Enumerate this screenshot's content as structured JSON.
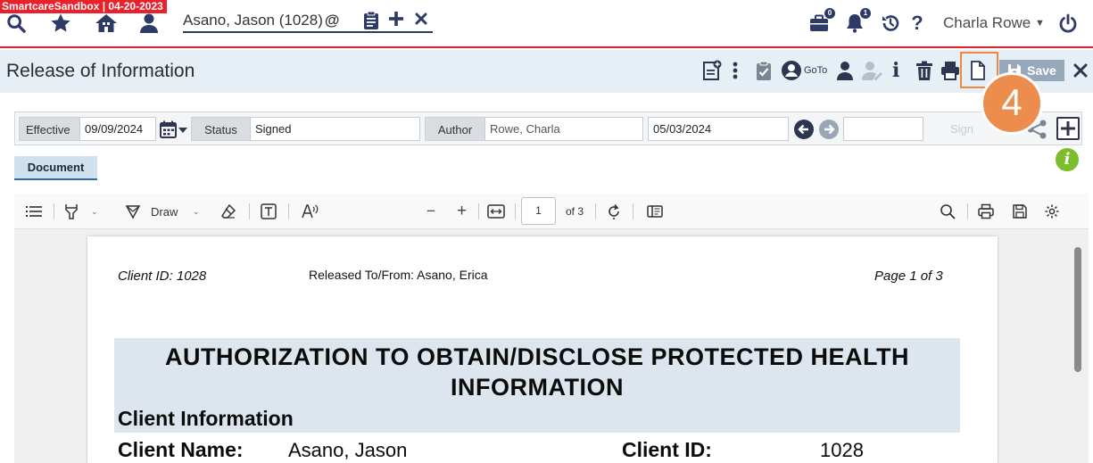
{
  "environment": {
    "badge": "SmartcareSandbox | 04-20-2023"
  },
  "nav": {
    "client_tab": {
      "label": "Asano, Jason (1028)",
      "at_symbol": "@"
    },
    "user": {
      "name": "Charla Rowe"
    },
    "notifications": {
      "briefcase_count": "0",
      "bell_count": "1"
    }
  },
  "title_bar": {
    "title": "Release of Information",
    "goto_label": "GoTo",
    "save_label": "Save"
  },
  "annotation": {
    "step": "4",
    "color": "#ec8c4d"
  },
  "form": {
    "effective_label": "Effective",
    "effective_value": "09/09/2024",
    "status_label": "Status",
    "status_value": "Signed",
    "author_label": "Author",
    "author_value": "Rowe, Charla",
    "date_value": "05/03/2024",
    "extra_value": "",
    "sign_label": "Sign",
    "info_glyph": "i"
  },
  "tabs": [
    {
      "label": "Document",
      "active": true
    }
  ],
  "pdf_viewer": {
    "toolbar": {
      "draw_label": "Draw",
      "page_current": "1",
      "page_total": "of 3",
      "zoom_out": "−",
      "zoom_in": "+"
    },
    "page": {
      "header_client_id": "Client ID: 1028",
      "header_released": "Released To/From: Asano, Erica",
      "header_page": "Page 1 of 3",
      "title": "AUTHORIZATION TO OBTAIN/DISCLOSE PROTECTED HEALTH INFORMATION",
      "section_heading": "Client Information",
      "client_name_label": "Client Name:",
      "client_name_value": "Asano, Jason",
      "client_id_label": "Client ID:",
      "client_id_value": "1028"
    }
  },
  "colors": {
    "accent": "#2e3a66",
    "brand_red": "#e8212a",
    "highlight": "#ec8840",
    "info_green": "#7cbd2b"
  }
}
